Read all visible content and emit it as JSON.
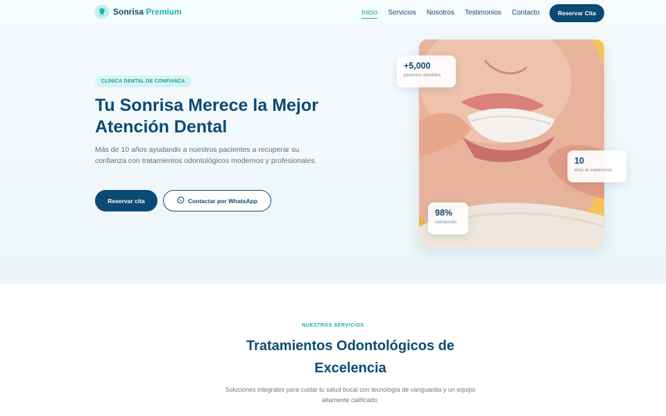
{
  "brand": {
    "name": "Sonrisa",
    "accent": "Premium",
    "icon": "tooth-icon"
  },
  "nav": {
    "links": [
      "Inicio",
      "Servicios",
      "Nosotros",
      "Testimonios",
      "Contacto"
    ],
    "active": "Inicio",
    "cta": "Reservar Cita"
  },
  "hero": {
    "badge": "CLÍNICA DENTAL DE CONFIANZA",
    "title": "Tu Sonrisa Merece la Mejor Atención Dental",
    "description": "Más de 10 años ayudando a nuestros pacientes a recuperar su confianza con tratamientos odontológicos modernos y profesionales.",
    "primary_button": "Reservar cita",
    "secondary_button": "Contactar por WhatsApp",
    "secondary_icon": "whatsapp-icon",
    "stats": [
      {
        "value": "+5,000",
        "label": "pacientes atendidos"
      },
      {
        "value": "10",
        "label": "años de experiencia"
      },
      {
        "value": "98%",
        "label": "satisfacción"
      }
    ]
  },
  "services": {
    "eyebrow": "NUESTROS SERVICIOS",
    "title": "Tratamientos Odontológicos de Excelencia",
    "description": "Soluciones integrales para cuidar tu salud bucal con tecnología de vanguardia y un equipo altamente calificado."
  },
  "colors": {
    "primary": "#0b4a74",
    "accent": "#13b8b0",
    "badge_bg": "#d7f3f1",
    "photo_bg": "#f2b43c"
  }
}
